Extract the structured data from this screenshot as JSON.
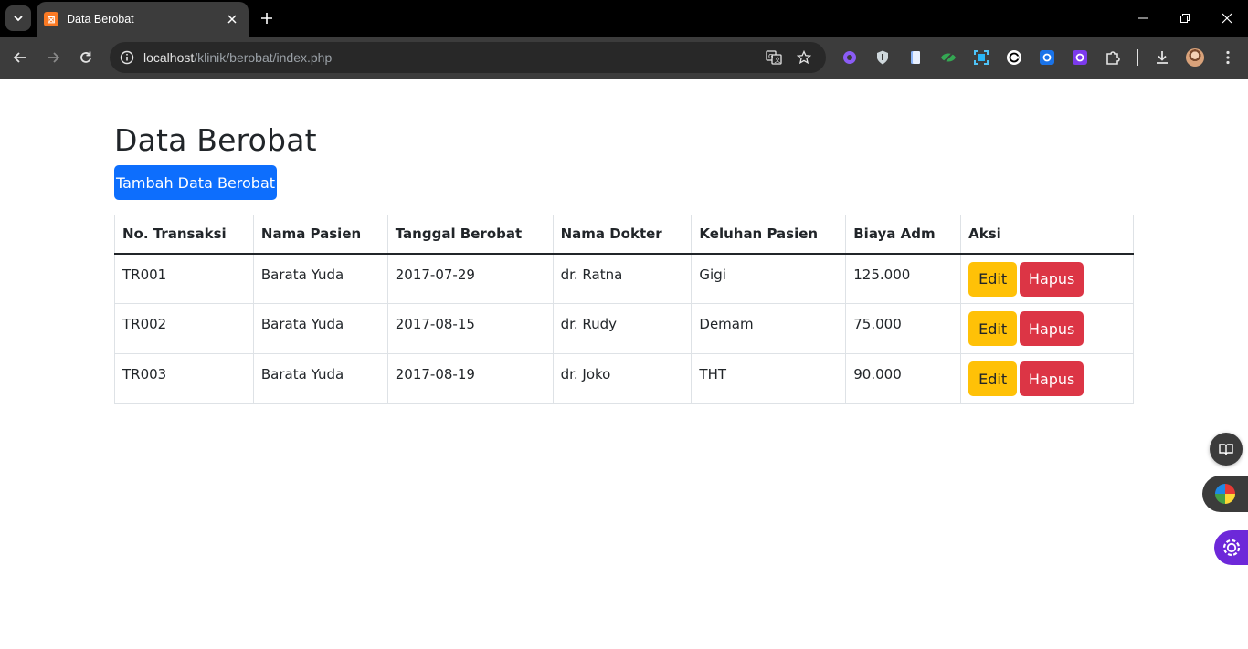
{
  "browser": {
    "tab_title": "Data Berobat",
    "url_host": "localhost",
    "url_path": "/klinik/berobat/index.php",
    "accent": "#0d6efd"
  },
  "page": {
    "title": "Data Berobat",
    "add_button": "Tambah Data Berobat"
  },
  "table": {
    "headers": [
      "No. Transaksi",
      "Nama Pasien",
      "Tanggal Berobat",
      "Nama Dokter",
      "Keluhan Pasien",
      "Biaya Adm",
      "Aksi"
    ],
    "rows": [
      {
        "no": "TR001",
        "pasien": "Barata Yuda",
        "tanggal": "2017-07-29",
        "dokter": "dr. Ratna",
        "keluhan": "Gigi",
        "biaya": "125.000"
      },
      {
        "no": "TR002",
        "pasien": "Barata Yuda",
        "tanggal": "2017-08-15",
        "dokter": "dr. Rudy",
        "keluhan": "Demam",
        "biaya": "75.000"
      },
      {
        "no": "TR003",
        "pasien": "Barata Yuda",
        "tanggal": "2017-08-19",
        "dokter": "dr. Joko",
        "keluhan": "THT",
        "biaya": "90.000"
      }
    ],
    "edit_label": "Edit",
    "delete_label": "Hapus"
  },
  "colors": {
    "edit": "#ffc107",
    "delete": "#dc3545",
    "primary": "#0d6efd"
  }
}
